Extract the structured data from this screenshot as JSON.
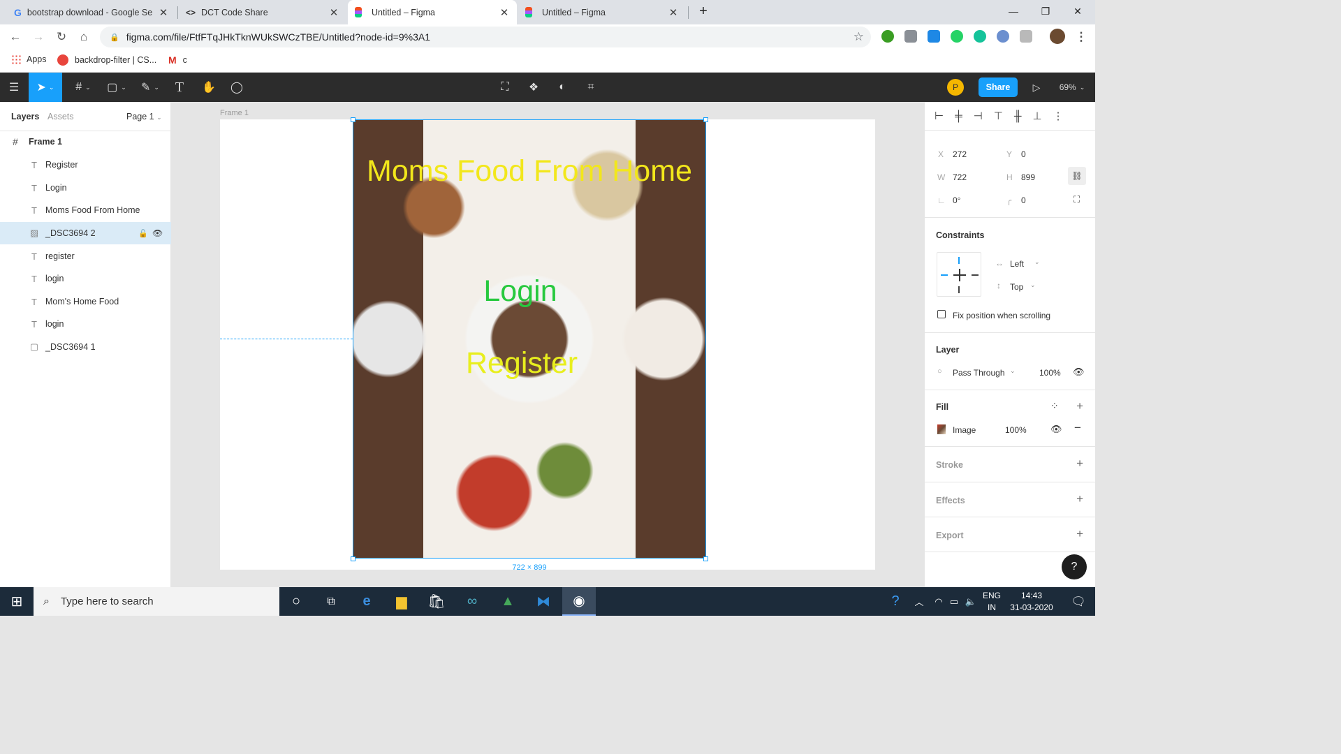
{
  "browser": {
    "tabs": [
      {
        "title": "bootstrap download - Google Se",
        "favicon": "google-icon"
      },
      {
        "title": "DCT Code Share",
        "favicon": "code-icon"
      },
      {
        "title": "Untitled – Figma",
        "favicon": "figma-icon"
      },
      {
        "title": "Untitled – Figma",
        "favicon": "figma-icon"
      }
    ],
    "url": "figma.com/file/FtfFTqJHkTknWUkSWCzTBE/Untitled?node-id=9%3A1",
    "bookmarks": [
      {
        "label": "Apps",
        "icon": "apps-grid-icon"
      },
      {
        "label": "backdrop-filter | CS...",
        "icon": "css-icon"
      },
      {
        "label": "c",
        "icon": "gmail-icon"
      }
    ]
  },
  "figma": {
    "avatar_letter": "P",
    "share_label": "Share",
    "zoom": "69%",
    "left_panel": {
      "tab_layers": "Layers",
      "tab_assets": "Assets",
      "page": "Page 1",
      "frame_name": "Frame 1",
      "layers": [
        {
          "name": "Register",
          "type": "text"
        },
        {
          "name": "Login",
          "type": "text"
        },
        {
          "name": "Moms Food From Home",
          "type": "text"
        },
        {
          "name": "_DSC3694 2",
          "type": "image",
          "selected": true
        },
        {
          "name": "register",
          "type": "text"
        },
        {
          "name": "login",
          "type": "text"
        },
        {
          "name": "Mom's Home Food",
          "type": "text"
        },
        {
          "name": "login",
          "type": "text"
        },
        {
          "name": "_DSC3694 1",
          "type": "rect"
        }
      ]
    },
    "canvas": {
      "frame_label": "Frame 1",
      "title_text": "Moms Food From Home",
      "login_text": "Login",
      "register_text": "Register",
      "size_label": "722 × 899",
      "colors": {
        "title": "#f2e71b",
        "login": "#27c93f",
        "register": "#e8ee1e",
        "selection": "#18a0fb"
      }
    },
    "right_panel": {
      "x_label": "X",
      "x": "272",
      "y_label": "Y",
      "y": "0",
      "w_label": "W",
      "w": "722",
      "h_label": "H",
      "h": "899",
      "rotation": "0°",
      "radius": "0",
      "constraints_title": "Constraints",
      "constraint_h": "Left",
      "constraint_v": "Top",
      "fix_scroll": "Fix position when scrolling",
      "layer_title": "Layer",
      "blend": "Pass Through",
      "opacity": "100%",
      "fill_title": "Fill",
      "fill_type": "Image",
      "fill_opacity": "100%",
      "stroke_title": "Stroke",
      "effects_title": "Effects",
      "export_title": "Export",
      "help": "?"
    }
  },
  "taskbar": {
    "search_placeholder": "Type here to search",
    "lang_top": "ENG",
    "lang_bottom": "IN",
    "time": "14:43",
    "date": "31-03-2020"
  }
}
